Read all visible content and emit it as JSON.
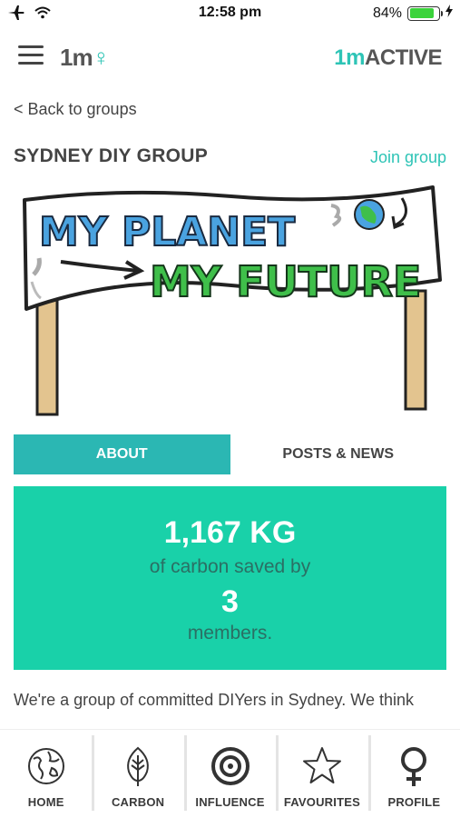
{
  "status_bar": {
    "time": "12:58 pm",
    "battery_percent_text": "84%",
    "battery_level": 0.84,
    "icons": [
      "airplane-icon",
      "wifi-icon",
      "battery-icon",
      "charging-icon"
    ]
  },
  "header": {
    "logo_left": "1m",
    "logo_left_symbol": "♀",
    "logo_right_prefix": "1m",
    "logo_right_suffix": "ACTIVE"
  },
  "nav": {
    "back_label": "< Back to groups"
  },
  "group": {
    "title": "SYDNEY DIY GROUP",
    "join_label": "Join group"
  },
  "banner": {
    "line1": "MY PLANET",
    "line2": "MY FUTURE"
  },
  "tabs": [
    {
      "label": "ABOUT",
      "active": true
    },
    {
      "label": "POSTS & NEWS",
      "active": false
    }
  ],
  "stats": {
    "amount": "1,167 KG",
    "line1": "of carbon saved by",
    "members": "3",
    "line2": "members."
  },
  "description": "We're a group of committed DIYers in Sydney. We think",
  "bottom_nav": [
    {
      "label": "HOME",
      "icon": "globe-icon"
    },
    {
      "label": "CARBON",
      "icon": "leaf-icon"
    },
    {
      "label": "INFLUENCE",
      "icon": "target-icon"
    },
    {
      "label": "FAVOURITES",
      "icon": "star-icon"
    },
    {
      "label": "PROFILE",
      "icon": "female-symbol-icon"
    }
  ],
  "colors": {
    "accent": "#2ec4b6",
    "tab_active": "#2bb7b3",
    "stats_bg": "#19d1a9",
    "text": "#444444",
    "banner_blue": "#4aa3e0",
    "banner_green": "#3fbf4a"
  }
}
